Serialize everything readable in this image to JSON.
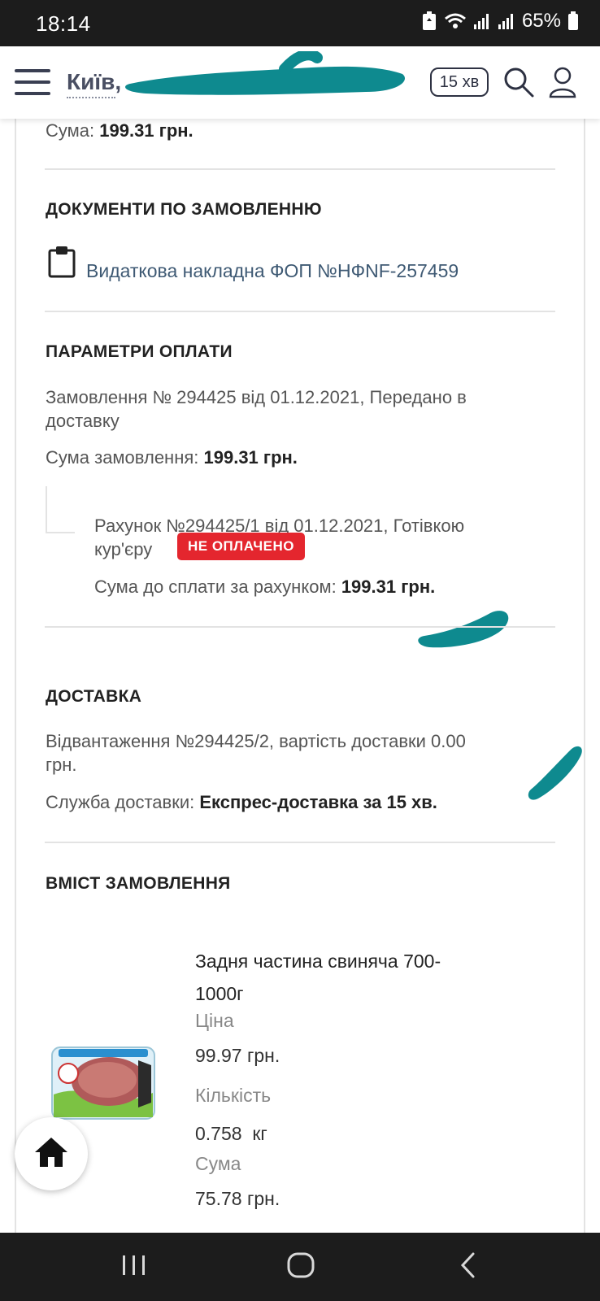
{
  "status_bar": {
    "time": "18:14",
    "battery": "65%",
    "icons": [
      "recycle-icon",
      "wifi-icon",
      "signal-icon",
      "signal-icon",
      "battery-icon"
    ]
  },
  "header": {
    "city": "Київ,",
    "delivery_time": "15 хв",
    "icons": [
      "menu-icon",
      "search-icon",
      "user-icon"
    ]
  },
  "summary": {
    "sum_label": "Сума:",
    "sum_value": "199.31 грн."
  },
  "documents": {
    "heading": "ДОКУМЕНТИ ПО ЗАМОВЛЕННЮ",
    "link": "Видаткова накладна ФОП №НФNF-257459",
    "icon": "clipboard-icon"
  },
  "payment": {
    "heading": "ПАРАМЕТРИ ОПЛАТИ",
    "order_line1": "Замовлення № 294425 від 01.12.2021, Передано в",
    "order_line2": "доставку",
    "order_sum_label": "Сума замовлення:",
    "order_sum_value": "199.31 грн.",
    "invoice_line1": "Рахунок №294425/1 від 01.12.2021, Готівкою",
    "invoice_line2": "кур'єру",
    "status_badge": "НЕ ОПЛАЧЕНО",
    "invoice_sum_label": "Сума до сплати за рахунком:",
    "invoice_sum_value": "199.31 грн."
  },
  "delivery": {
    "heading": "ДОСТАВКА",
    "shipment_line1": "Відвантаження №294425/2, вартість доставки 0.00",
    "shipment_line2": "грн.",
    "service_label": "Служба доставки:",
    "service_value": "Експрес-доставка за 15 хв."
  },
  "contents": {
    "heading": "ВМІСТ ЗАМОВЛЕННЯ",
    "items": [
      {
        "name_line1": "Задня частина свиняча 700-",
        "name_line2": "1000г",
        "price_label": "Ціна",
        "price": "99.97 грн.",
        "qty_label": "Кількість",
        "qty": "0.758  кг",
        "sum_label": "Сума",
        "sum": "75.78 грн."
      }
    ]
  },
  "colors": {
    "accent_teal": "#0e8a8f",
    "badge_red": "#e4262e",
    "link": "#3f5a74"
  },
  "fab": {
    "icon": "home-icon"
  },
  "nav_bar": {
    "icons": [
      "recent-apps-icon",
      "home-circle-icon",
      "back-icon"
    ]
  }
}
